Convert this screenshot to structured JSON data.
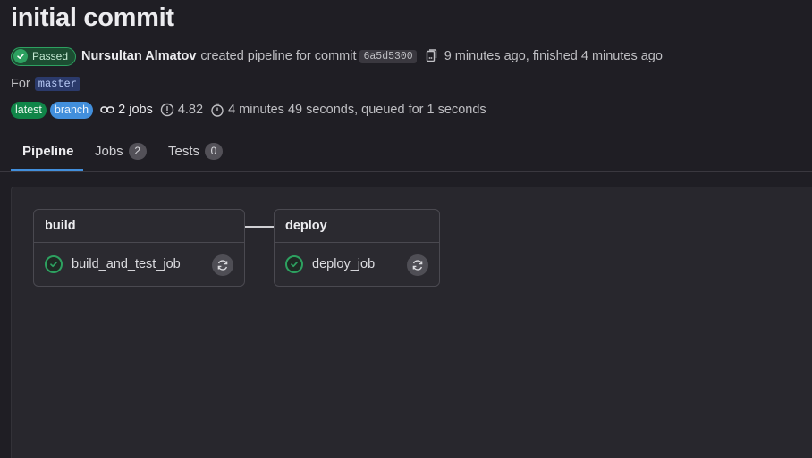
{
  "header": {
    "title": "initial commit",
    "status": "Passed",
    "author": "Nursultan Almatov",
    "created_text": "created pipeline for commit",
    "commit_sha": "6a5d5300",
    "time_text": "9 minutes ago, finished 4 minutes ago",
    "for_text": "For",
    "branch": "master",
    "badges": {
      "latest": "latest",
      "branch": "branch"
    },
    "jobs_count": "2 jobs",
    "compute": "4.82",
    "duration": "4 minutes 49 seconds, queued for 1 seconds"
  },
  "tabs": {
    "pipeline": {
      "label": "Pipeline"
    },
    "jobs": {
      "label": "Jobs",
      "count": "2"
    },
    "tests": {
      "label": "Tests",
      "count": "0"
    }
  },
  "stages": [
    {
      "name": "build",
      "jobs": [
        {
          "name": "build_and_test_job",
          "status": "success"
        }
      ]
    },
    {
      "name": "deploy",
      "jobs": [
        {
          "name": "deploy_job",
          "status": "success"
        }
      ]
    }
  ],
  "colors": {
    "success": "#2da160",
    "tab_accent": "#428fdc",
    "background": "#1f1e24"
  },
  "icons": [
    "check-circle-icon",
    "copy-icon",
    "link-icon",
    "compute-icon",
    "timer-icon",
    "retry-icon"
  ]
}
